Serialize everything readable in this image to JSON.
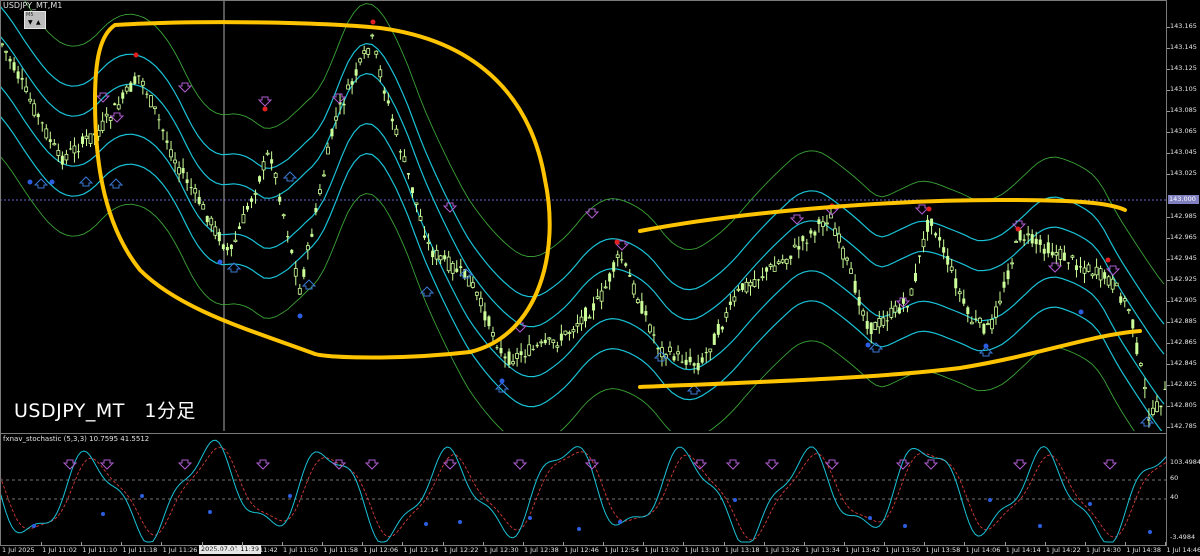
{
  "symbol_title": "USDJPY_MT,M1",
  "trade_widget": {
    "label": "M5",
    "sell_icon": "triangle-down",
    "buy_icon": "triangle-up"
  },
  "overlay_label": "USDJPY_MT　1分足",
  "indicator_title": "fxnav_stochastic (5,3,3) 10.7595 41.5512",
  "price_axis": {
    "ticks": [
      "143.165",
      "143.145",
      "143.125",
      "143.105",
      "143.085",
      "143.065",
      "143.045",
      "143.025",
      "142.985",
      "142.965",
      "142.945",
      "142.925",
      "142.905",
      "142.885",
      "142.865",
      "142.845",
      "142.825",
      "142.805",
      "142.785"
    ],
    "current_price": "143.000"
  },
  "sub_axis": {
    "ticks": [
      "103.4984",
      "60",
      "40",
      "-3.4984"
    ]
  },
  "time_axis": {
    "ticks": [
      "1 Jul 2025",
      "1 Jul 11:02",
      "1 Jul 11:10",
      "1 Jul 11:18",
      "1 Jul 11:26",
      "1 Jul 11:34",
      "1 Jul 11:42",
      "1 Jul 11:50",
      "1 Jul 11:58",
      "1 Jul 12:06",
      "1 Jul 12:14",
      "1 Jul 12:22",
      "1 Jul 12:30",
      "1 Jul 12:38",
      "1 Jul 12:46",
      "1 Jul 12:54",
      "1 Jul 13:02",
      "1 Jul 13:10",
      "1 Jul 13:18",
      "1 Jul 13:26",
      "1 Jul 13:34",
      "1 Jul 13:42",
      "1 Jul 13:50",
      "1 Jul 13:58",
      "1 Jul 14:06",
      "1 Jul 14:14",
      "1 Jul 14:22",
      "1 Jul 14:30",
      "1 Jul 14:38",
      "1 Jul 14:46"
    ],
    "crosshair_label": "2025.07.01 11:39"
  },
  "colors": {
    "background": "#000000",
    "bull_candle": "#ccff99",
    "band_inner": "#19c2d6",
    "band_outer": "#3aa336",
    "annotation": "#ffc400",
    "stoch_main": "#19c2d6",
    "stoch_signal": "#d63a3a",
    "arrow_down": "#b05dd0",
    "arrow_up": "#3b7ad6",
    "high_dot": "#e02020",
    "low_dot": "#2b5ee0"
  },
  "chart_data": {
    "type": "candlestick",
    "y_axis_range": [
      142.775,
      143.175
    ],
    "current_price_line": 143.0,
    "stochastic": {
      "params": "5,3,3",
      "main": 10.7595,
      "signal": 41.5512,
      "levels": [
        60,
        40
      ],
      "range": [
        -3.4984,
        103.4984
      ]
    }
  }
}
